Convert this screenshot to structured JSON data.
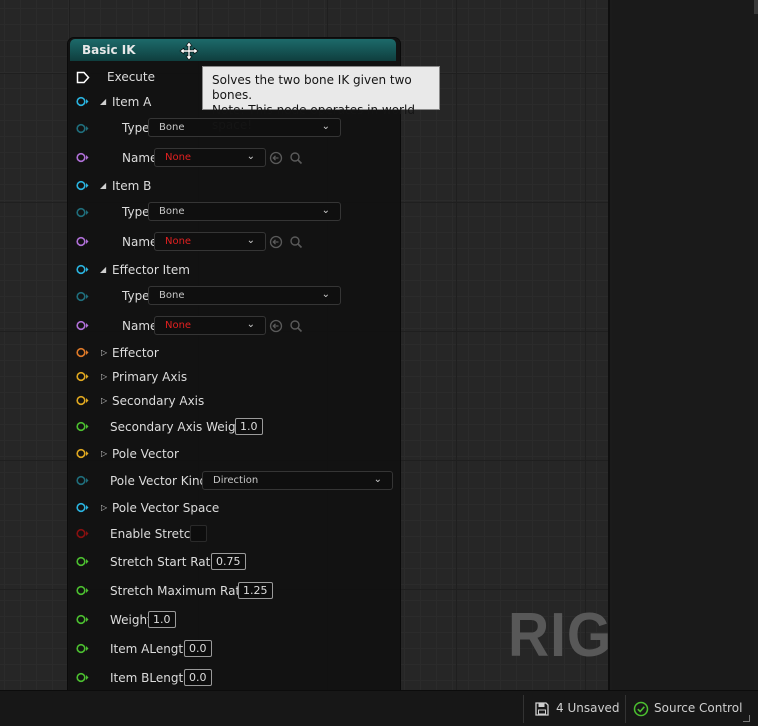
{
  "node": {
    "title": "Basic IK",
    "execute_label": "Execute",
    "item_a": {
      "label": "Item A",
      "type_label": "Type",
      "type_value": "Bone",
      "name_label": "Name",
      "name_value": "None"
    },
    "item_b": {
      "label": "Item B",
      "type_label": "Type",
      "type_value": "Bone",
      "name_label": "Name",
      "name_value": "None"
    },
    "effector_item": {
      "label": "Effector Item",
      "type_label": "Type",
      "type_value": "Bone",
      "name_label": "Name",
      "name_value": "None"
    },
    "effector_label": "Effector",
    "primary_axis_label": "Primary Axis",
    "secondary_axis_label": "Secondary Axis",
    "secondary_axis_weight": {
      "label": "Secondary Axis Weight",
      "value": "1.0"
    },
    "pole_vector_label": "Pole Vector",
    "pole_vector_kind": {
      "label": "Pole Vector Kind",
      "value": "Direction"
    },
    "pole_vector_space_label": "Pole Vector Space",
    "enable_stretch_label": "Enable Stretch",
    "stretch_start_ratio": {
      "label": "Stretch Start Ratio",
      "value": "0.75"
    },
    "stretch_maximum_ratio": {
      "label": "Stretch Maximum Ratio",
      "value": "1.25"
    },
    "weight": {
      "label": "Weight",
      "value": "1.0"
    },
    "item_a_length": {
      "label": "Item ALength",
      "value": "0.0"
    },
    "item_b_length": {
      "label": "Item BLength",
      "value": "0.0"
    }
  },
  "tooltip": {
    "line1": "Solves the two bone IK given two bones.",
    "line2": "Note: This node operates in world space!"
  },
  "watermark": "RIG",
  "status_bar": {
    "unsaved": "4 Unsaved",
    "source_control": "Source Control"
  },
  "icons": {
    "header": "move-cursor-icon",
    "name_actions": [
      "use-selected-arrow-icon",
      "browse-search-icon"
    ],
    "unsaved": "save-disk-icon",
    "source_control": "check-circle-icon"
  },
  "colors": {
    "node_header": "#145050",
    "pin_cyan": "#2ab4e0",
    "pin_teal": "#1f6e7c",
    "pin_purple": "#b070d8",
    "pin_orange": "#e07a28",
    "pin_yellow": "#e0a820",
    "pin_green": "#4cc030",
    "pin_red": "#8a1010",
    "none_text": "#e02020"
  }
}
